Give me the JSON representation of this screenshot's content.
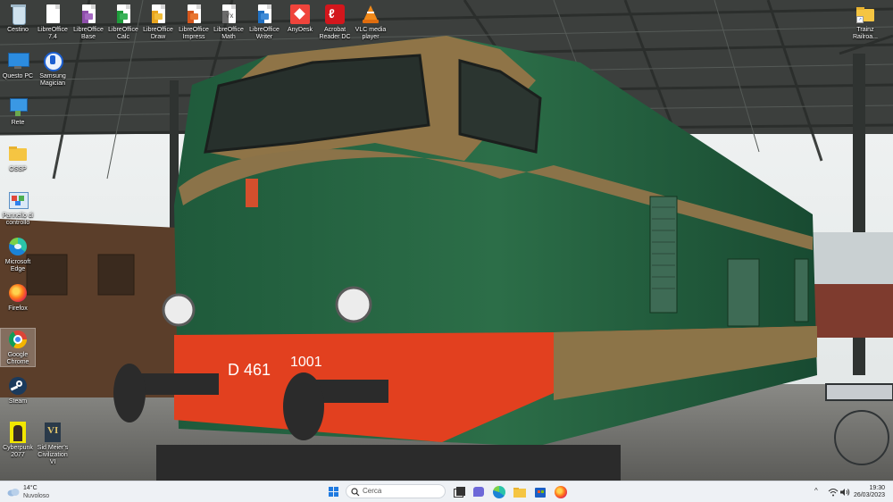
{
  "desktop": {
    "wallpaper": "green-and-orange-diesel-locomotive-under-station-canopy",
    "locomotive_markings": [
      "D 461",
      "1001"
    ],
    "icons": [
      {
        "label": "Cestino",
        "icon": "recycle-bin-icon"
      },
      {
        "label": "LibreOffice\n7.4",
        "icon": "libreoffice-icon"
      },
      {
        "label": "LibreOffice\nBase",
        "icon": "libreoffice-base-icon"
      },
      {
        "label": "LibreOffice\nCalc",
        "icon": "libreoffice-calc-icon"
      },
      {
        "label": "LibreOffice\nDraw",
        "icon": "libreoffice-draw-icon"
      },
      {
        "label": "LibreOffice\nImpress",
        "icon": "libreoffice-impress-icon"
      },
      {
        "label": "LibreOffice\nMath",
        "icon": "libreoffice-math-icon"
      },
      {
        "label": "LibreOffice\nWriter",
        "icon": "libreoffice-writer-icon"
      },
      {
        "label": "AnyDesk",
        "icon": "anydesk-icon"
      },
      {
        "label": "Acrobat\nReader DC",
        "icon": "acrobat-reader-icon"
      },
      {
        "label": "VLC media\nplayer",
        "icon": "vlc-icon"
      },
      {
        "label": "Trainz\nRailroa...",
        "icon": "folder-shortcut-icon"
      },
      {
        "label": "Questo PC",
        "icon": "this-pc-icon"
      },
      {
        "label": "Samsung\nMagician",
        "icon": "samsung-magician-icon"
      },
      {
        "label": "Rete",
        "icon": "network-icon"
      },
      {
        "label": "OSSP",
        "icon": "folder-icon"
      },
      {
        "label": "Pannello di\ncontrollo",
        "icon": "control-panel-icon"
      },
      {
        "label": "Microsoft\nEdge",
        "icon": "edge-icon"
      },
      {
        "label": "Firefox",
        "icon": "firefox-icon"
      },
      {
        "label": "Google\nChrome",
        "icon": "chrome-icon"
      },
      {
        "label": "Steam",
        "icon": "steam-icon"
      },
      {
        "label": "Cyberpunk\n2077",
        "icon": "cyberpunk-icon"
      },
      {
        "label": "Sid Meier's\nCivilization VI",
        "icon": "civilization-icon"
      }
    ]
  },
  "taskbar": {
    "weather": {
      "temp": "14°C",
      "condition": "Nuvoloso",
      "icon": "cloud-icon"
    },
    "start_icon": "windows-start-icon",
    "search": {
      "placeholder": "Cerca",
      "icon": "search-icon"
    },
    "pinned": [
      "task-view-icon",
      "teams-chat-icon",
      "edge-icon",
      "file-explorer-icon",
      "microsoft-store-icon",
      "firefox-icon"
    ],
    "tray": {
      "chevron": "^",
      "wifi": "wifi-icon",
      "volume": "volume-icon"
    },
    "clock": {
      "time": "19:30",
      "date": "26/03/2023"
    }
  }
}
